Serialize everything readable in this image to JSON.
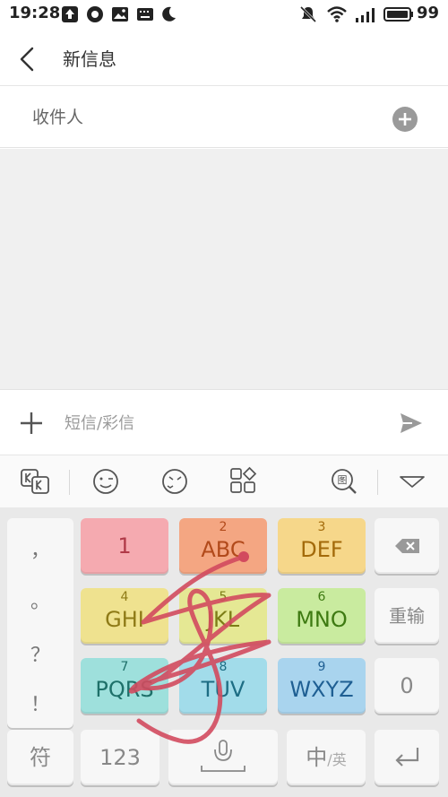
{
  "status_bar": {
    "time": "19:28",
    "battery": "99",
    "icons": [
      "upload-icon",
      "camera-shutter-icon",
      "image-icon",
      "keyboard-icon",
      "moon-icon",
      "mute-icon",
      "wifi-icon",
      "signal-icon",
      "battery-icon"
    ]
  },
  "header": {
    "title": "新信息",
    "back_icon": "back-arrow-icon"
  },
  "recipient": {
    "placeholder": "收件人",
    "value": "",
    "add_icon": "add-contact-icon"
  },
  "compose": {
    "placeholder": "短信/彩信",
    "value": "",
    "attach_icon": "plus-icon",
    "send_icon": "send-icon"
  },
  "ime_toolbar": {
    "icons": [
      "kk-logo-icon",
      "emoji-icon",
      "emoticon-icon",
      "apps-grid-icon",
      "image-search-icon",
      "collapse-icon"
    ]
  },
  "keyboard": {
    "punctuation": [
      "，",
      "。",
      "？",
      "！"
    ],
    "keys": [
      {
        "num": "",
        "label": "1"
      },
      {
        "num": "2",
        "label": "ABC"
      },
      {
        "num": "3",
        "label": "DEF"
      },
      {
        "num": "4",
        "label": "GHI"
      },
      {
        "num": "5",
        "label": "JKL"
      },
      {
        "num": "6",
        "label": "MNO"
      },
      {
        "num": "7",
        "label": "PQRS"
      },
      {
        "num": "8",
        "label": "TUV"
      },
      {
        "num": "9",
        "label": "WXYZ"
      }
    ],
    "delete_icon": "backspace-icon",
    "reinput_label": "重输",
    "zero_label": "0",
    "symbol_label": "符",
    "numbers_label": "123",
    "mic_icon": "microphone-icon",
    "lang_label_cn": "中",
    "lang_label_en": "/英",
    "enter_icon": "enter-icon"
  },
  "colors": {
    "accent_trace": "#d24a5e",
    "background": "#f0f0f0"
  }
}
